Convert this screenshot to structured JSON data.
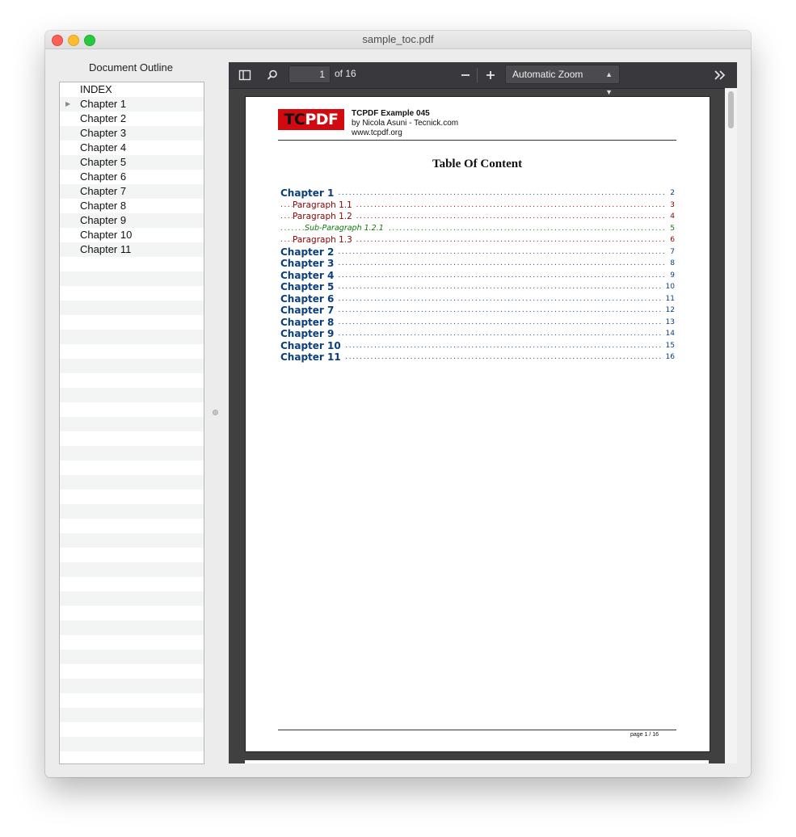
{
  "window": {
    "title": "sample_toc.pdf"
  },
  "outline": {
    "title": "Document Outline",
    "items": [
      {
        "label": "INDEX",
        "expandable": false
      },
      {
        "label": "Chapter 1",
        "expandable": true
      },
      {
        "label": "Chapter 2",
        "expandable": false
      },
      {
        "label": "Chapter 3",
        "expandable": false
      },
      {
        "label": "Chapter 4",
        "expandable": false
      },
      {
        "label": "Chapter 5",
        "expandable": false
      },
      {
        "label": "Chapter 6",
        "expandable": false
      },
      {
        "label": "Chapter 7",
        "expandable": false
      },
      {
        "label": "Chapter 8",
        "expandable": false
      },
      {
        "label": "Chapter 9",
        "expandable": false
      },
      {
        "label": "Chapter 10",
        "expandable": false
      },
      {
        "label": "Chapter 11",
        "expandable": false
      }
    ]
  },
  "toolbar": {
    "page_number": "1",
    "page_count_text": "of 16",
    "zoom_value": "Automatic Zoom",
    "icons": [
      "sidebar-toggle-icon",
      "search-icon",
      "zoom-out-icon",
      "zoom-in-icon",
      "tools-icon"
    ]
  },
  "page": {
    "logo_text_dark": "TC",
    "logo_text_light": "PDF",
    "header_title": "TCPDF Example 045",
    "header_author": "by Nicola Asuni - Tecnick.com",
    "header_url": "www.tcpdf.org",
    "toc_title": "Table Of Content",
    "toc_entries": [
      {
        "label": "Chapter 1",
        "page": "2",
        "level": 0
      },
      {
        "label": "Paragraph 1.1",
        "page": "3",
        "level": 1
      },
      {
        "label": "Paragraph 1.2",
        "page": "4",
        "level": 1
      },
      {
        "label": "Sub-Paragraph 1.2.1",
        "page": "5",
        "level": 2
      },
      {
        "label": "Paragraph 1.3",
        "page": "6",
        "level": 1
      },
      {
        "label": "Chapter 2",
        "page": "7",
        "level": 0
      },
      {
        "label": "Chapter 3",
        "page": "8",
        "level": 0
      },
      {
        "label": "Chapter 4",
        "page": "9",
        "level": 0
      },
      {
        "label": "Chapter 5",
        "page": "10",
        "level": 0
      },
      {
        "label": "Chapter 6",
        "page": "11",
        "level": 0
      },
      {
        "label": "Chapter 7",
        "page": "12",
        "level": 0
      },
      {
        "label": "Chapter 8",
        "page": "13",
        "level": 0
      },
      {
        "label": "Chapter 9",
        "page": "14",
        "level": 0
      },
      {
        "label": "Chapter 10",
        "page": "15",
        "level": 0
      },
      {
        "label": "Chapter 11",
        "page": "16",
        "level": 0
      }
    ],
    "footer": "page 1 / 16"
  },
  "colors": {
    "chapter": "#0a3f7c",
    "paragraph": "#8b0000",
    "subparagraph": "#0a7a0a",
    "logo_red": "#d20a10",
    "toolbar": "#38383d"
  }
}
